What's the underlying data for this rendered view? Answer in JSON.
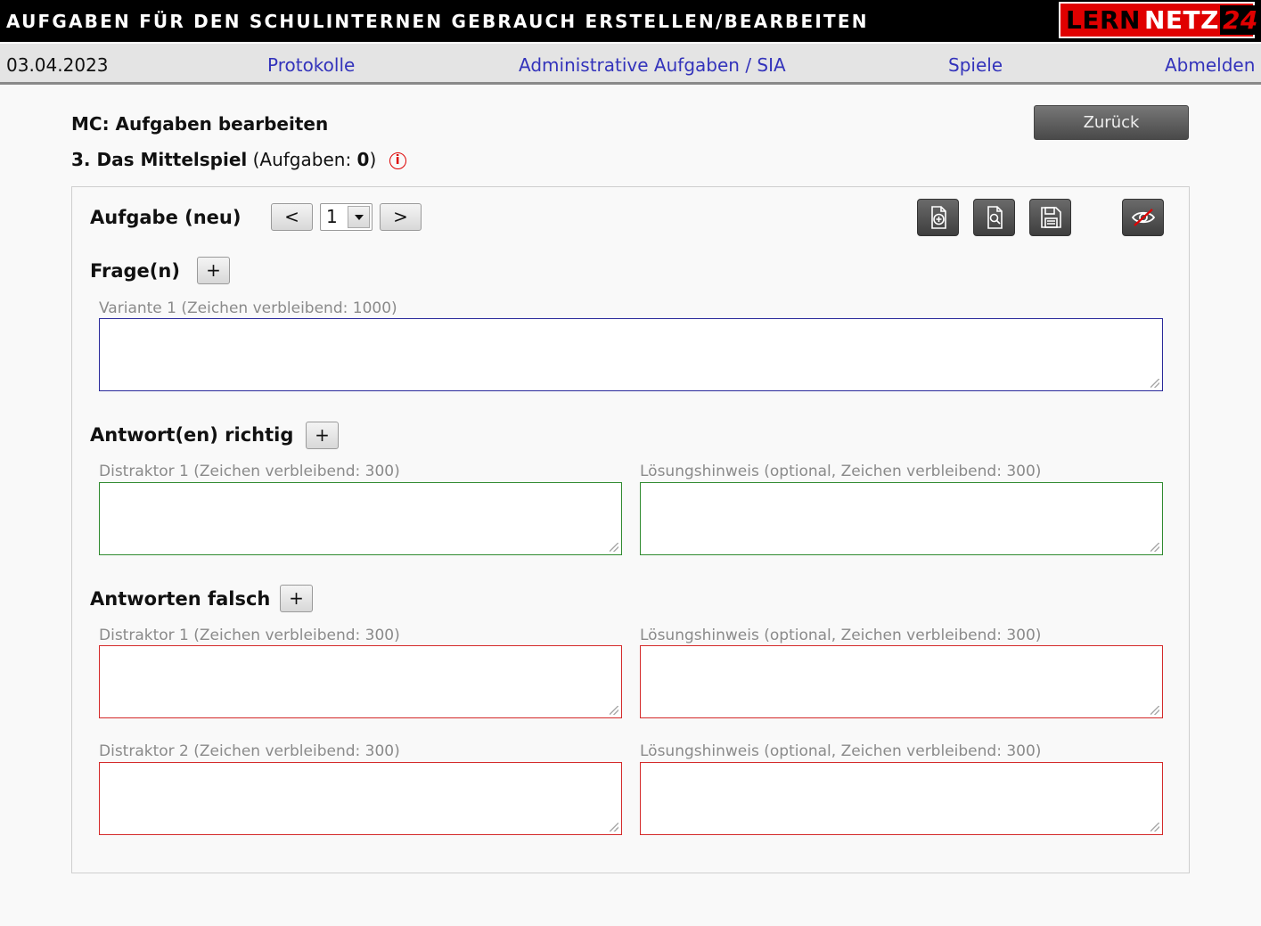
{
  "header": {
    "title": "AUFGABEN FÜR DEN SCHULINTERNEN GEBRAUCH ERSTELLEN/BEARBEITEN",
    "logo": {
      "part1": "LERN",
      "part2": "NETZ",
      "part3": "24"
    }
  },
  "nav": {
    "date": "03.04.2023",
    "links": [
      "Protokolle",
      "Administrative Aufgaben / SIA",
      "Spiele",
      "Abmelden"
    ]
  },
  "page": {
    "title": "MC: Aufgaben bearbeiten",
    "chapter_name": "3. Das Mittelspiel",
    "chapter_count_prefix": "(Aufgaben: ",
    "chapter_count": "0",
    "chapter_count_suffix": ")",
    "back_label": "Zurück",
    "info_icon": "info-circle-icon"
  },
  "task": {
    "label": "Aufgabe (neu)",
    "prev": "<",
    "next": ">",
    "selected": "1",
    "tools": [
      "new-document-icon",
      "preview-icon",
      "save-icon",
      "visibility-off-icon"
    ]
  },
  "questions": {
    "label": "Frage(n)",
    "add": "+",
    "items": [
      {
        "label": "Variante 1 (Zeichen verbleibend: 1000)",
        "value": ""
      }
    ]
  },
  "correct": {
    "label": "Antwort(en) richtig",
    "add": "+",
    "items": [
      {
        "label": "Distraktor 1 (Zeichen verbleibend: 300)",
        "hint": "Lösungshinweis (optional, Zeichen verbleibend: 300)"
      }
    ]
  },
  "wrong": {
    "label": "Antworten falsch",
    "add": "+",
    "items": [
      {
        "label": "Distraktor 1 (Zeichen verbleibend: 300)",
        "hint": "Lösungshinweis (optional, Zeichen verbleibend: 300)"
      },
      {
        "label": "Distraktor 2 (Zeichen verbleibend: 300)",
        "hint": "Lösungshinweis (optional, Zeichen verbleibend: 300)"
      }
    ]
  },
  "colors": {
    "accent_red": "#e00000",
    "link_blue": "#3333bb",
    "correct_green": "#2f8a2f",
    "wrong_red": "#d42a2a"
  }
}
